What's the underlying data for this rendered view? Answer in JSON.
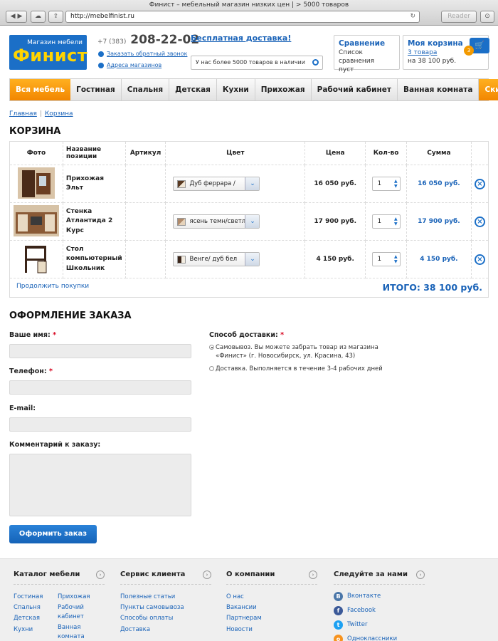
{
  "browser": {
    "window_title": "Финист – мебельный магазин низких цен | > 5000 товаров",
    "url": "http://mebelfinist.ru",
    "reader_label": "Reader"
  },
  "header": {
    "logo_top": "Магазин мебели",
    "logo_name": "Финист",
    "phone_code": "+7 (383)",
    "phone_number": "208-22-02",
    "callback_link": "Заказать обратный звонок",
    "stores_link": "Адреса магазинов",
    "free_delivery": "Бесплатная доставка!",
    "search_placeholder": "У нас более 5000 товаров в наличии",
    "compare": {
      "title": "Сравнение",
      "line1": "Список сравнения",
      "line2": "пуст"
    },
    "cart": {
      "title": "Моя корзина",
      "items_link": "3 товара",
      "amount": "на 38 100 руб.",
      "badge": "3"
    }
  },
  "nav": [
    "Вся мебель",
    "Гостиная",
    "Спальня",
    "Детская",
    "Кухни",
    "Прихожая",
    "Рабочий кабинет",
    "Ванная комната",
    "Скидки"
  ],
  "breadcrumbs": [
    "Главная",
    "Корзина"
  ],
  "cart_section": {
    "title": "КОРЗИНА",
    "columns": [
      "Фото",
      "Название позиции",
      "Артикул",
      "Цвет",
      "Цена",
      "Кол-во",
      "Сумма"
    ],
    "rows": [
      {
        "name": "Прихожая Эльт",
        "color": "Дуб феррара /",
        "price": "16 050 руб.",
        "qty": "1",
        "sum": "16 050 руб.",
        "swatch": "#5a3a22"
      },
      {
        "name": "Стенка Атлантида 2 Курс",
        "color": "ясень темн/светл",
        "price": "17 900 руб.",
        "qty": "1",
        "sum": "17 900 руб.",
        "swatch": "#b08a6a"
      },
      {
        "name": "Стол компьютерный Школьник",
        "color": "Венге/ дуб бел",
        "price": "4 150 руб.",
        "qty": "1",
        "sum": "4 150 руб.",
        "swatch": "#3a2418"
      }
    ],
    "continue_link": "Продолжить покупки",
    "total": "ИТОГО: 38 100 руб."
  },
  "order": {
    "title": "ОФОРМЛЕНИЕ ЗАКАЗА",
    "name_label": "Ваше имя:",
    "phone_label": "Телефон:",
    "email_label": "E-mail:",
    "comment_label": "Комментарий к заказу:",
    "required_mark": "*",
    "delivery_label": "Способ доставки:",
    "option1": "Самовывоз. Вы можете забрать товар из магазина «Финист» (г. Новосибирск, ул. Красина, 43)",
    "option2": "Доставка. Выполняется в течение 3-4 рабочих дней",
    "submit": "Оформить заказ"
  },
  "footer": {
    "catalog": {
      "title": "Каталог мебели",
      "left": [
        "Гостиная",
        "Спальня",
        "Детская",
        "Кухни"
      ],
      "right": [
        "Прихожая",
        "Рабочий кабинет",
        "Ванная комната"
      ]
    },
    "service": {
      "title": "Сервис клиента",
      "links": [
        "Полезные статьи",
        "Пункты самовывоза",
        "Способы оплаты",
        "Доставка"
      ]
    },
    "company": {
      "title": "О компании",
      "links": [
        "О нас",
        "Вакансии",
        "Партнерам",
        "Новости"
      ]
    },
    "social": {
      "title": "Следуйте за нами",
      "links": [
        "Вконтакте",
        "Facebook",
        "Twitter",
        "Одноклассники"
      ]
    }
  },
  "colors": {
    "brand_blue": "#1b6fc7",
    "accent_orange": "#f39a00",
    "logo_yellow": "#ffd400"
  }
}
